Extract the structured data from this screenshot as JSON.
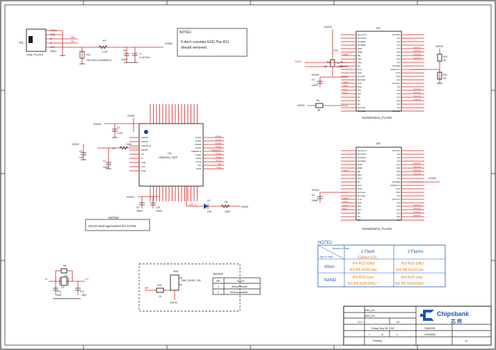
{
  "sheet": {
    "border_cols": [
      "1",
      "2",
      "3",
      "4",
      "5",
      "6"
    ],
    "border_rows": [
      "A",
      "B",
      "C",
      "D"
    ]
  },
  "p1": {
    "ref": "P1",
    "part": "USB_PLUGA",
    "pins": [
      "SHELL",
      "GND",
      "D+",
      "D-",
      "VCC",
      "SHELL",
      "SHELL"
    ],
    "nets": [
      "DM",
      "DP"
    ]
  },
  "r7": {
    "ref": "R7",
    "value": "2.2R"
  },
  "r11": {
    "ref": "R11",
    "value": "TDK AVRL161M9R0KTA"
  },
  "c6": {
    "ref": "C6",
    "value": "100nF"
  },
  "c7": {
    "ref": "C7",
    "value": "4.7uF/10V"
  },
  "vdd50": "VDD50",
  "note1": {
    "title": "NOTE1:",
    "lines": [
      "If don't consider ESD,The  R11",
      "should removed ."
    ]
  },
  "u3": {
    "ref": "U3",
    "part": "CBM2093_TQFP",
    "left_pins": [
      "VDD50",
      "VDD33",
      "VDD18_IN",
      "RESET",
      "XO",
      "XI",
      "TSB",
      "VCC",
      "GND"
    ],
    "right_pins": [
      "FOEN",
      "FCEN",
      "FWEN",
      "FCEN",
      "FRESETN",
      "FCEN",
      "FALE",
      "FCLE",
      "WP",
      "FR/B"
    ]
  },
  "c2": {
    "ref": "C2",
    "value": "4.7uF"
  },
  "c3": {
    "ref": "C3",
    "value": "1uF"
  },
  "c1": {
    "ref": "C1",
    "value": "100nF"
  },
  "r2": {
    "ref": "R2",
    "value": "100K"
  },
  "vdd33": "VDD33",
  "c9": {
    "ref": "C9",
    "value": "100nF"
  },
  "c10": {
    "ref": "C10",
    "value": "100nF"
  },
  "d1": {
    "ref": "D1",
    "part": "LED",
    "net": "LED_D"
  },
  "r6": {
    "ref": "R6",
    "value": "330R"
  },
  "note2": {
    "title": "NOTE2:",
    "text": "C8,C9 need Approaches the 13 PIN"
  },
  "u1": {
    "ref": "U1",
    "part": "NAND/43nm_FLASH",
    "left_pins": [
      "NC/VCC1",
      "NC/VSS1",
      "NC/R/B1",
      "NC/R/B2",
      "R/B1",
      "R/B2",
      "RE",
      "CE1",
      "CE2",
      "NC",
      "VCC",
      "VSS",
      "NC/CE3",
      "NC/CE4",
      "CLE",
      "ALE",
      "WE",
      "WP",
      "NC",
      "NC",
      "NC",
      "NC/VSS",
      "NC/VCC"
    ],
    "right_pins": [
      "NC/VSS",
      "NC",
      "NC",
      "NC",
      "IO7",
      "IO6",
      "IO5",
      "IO4",
      "NC",
      "NC/PRE",
      "PRE/VCC",
      "VCC",
      "VSS",
      "NC",
      "NC/VCC",
      "NC",
      "IO3",
      "IO2",
      "IO1",
      "IO0",
      "NC",
      "NC",
      "NC/VSS"
    ]
  },
  "u4": {
    "ref": "U4",
    "part": "NAND/43nm_FLASH"
  },
  "r3": {
    "ref": "R3",
    "value": "0R"
  },
  "r4": {
    "ref": "R4",
    "value": "2.2K"
  },
  "r5": {
    "ref": "R5",
    "value": "0R"
  },
  "r8": {
    "ref": "R8",
    "value": "0R"
  },
  "r24": {
    "ref": "R24",
    "value": "0R"
  },
  "r22": {
    "ref": "R22",
    "value": "0R"
  },
  "c4": {
    "ref": "C4",
    "value": "100nF"
  },
  "c5": {
    "ref": "C5",
    "value": "100nF"
  },
  "c11": {
    "ref": "C11",
    "value": "100nF"
  },
  "fdata": [
    "FDATA0",
    "FDATA1",
    "FDATA2",
    "FDATA3",
    "FDATA4",
    "FDATA5",
    "FDATA6",
    "FDATA7"
  ],
  "fnets": [
    "FREN",
    "FWEN",
    "FCEN",
    "FCLE",
    "FALE",
    "FR/B"
  ],
  "x1": {
    "ref": "X1",
    "part": "12MHz",
    "nets": [
      "XI",
      "XO"
    ]
  },
  "c12": {
    "ref": "C12",
    "value": "22pF"
  },
  "c13": {
    "ref": "C13",
    "value": "22pF"
  },
  "r5x": {
    "ref": "R5",
    "value": "1M"
  },
  "sw1": {
    "ref": "SW1",
    "part": "SMD_SLIDE_SW"
  },
  "r15": {
    "ref": "R15",
    "value": "1K"
  },
  "wp_net": "WP",
  "note3": {
    "title": "NOTE3:",
    "headers": [
      "WP",
      "MODE"
    ],
    "rows": [
      [
        "0",
        "Write protected"
      ],
      [
        "1",
        "Normal operation"
      ]
    ]
  },
  "note_table": {
    "title": "NOTE2:",
    "corner_top": "Number of Flash",
    "corner_bottom": "Type of Flash",
    "col1": "1 Flash",
    "col1_sub": "(Select U1)",
    "col2": "2 Flashs",
    "rows": [
      {
        "type": "43nm",
        "c1a": "R4    R22-DNU",
        "c1b": "R3   R5   R24-Use",
        "c2a": "R3    R22-DNU",
        "c2b": "R4   R5   R24-Use"
      },
      {
        "type": "NAND",
        "c1a": "R3    R22-Use",
        "c1b": "R4   R5   R24-DNU",
        "c2a": "R4    R22-Use",
        "c2b": "R3   R5   R24-DNU"
      }
    ]
  },
  "title_block": {
    "designer": "Allen_DU",
    "checker": "Allen_DU",
    "version": "V1.0",
    "size": "A3",
    "date": "Friday, May 08, 2009",
    "sheet": "1",
    "of": "of",
    "sheets": "1",
    "company": "Chipsbank",
    "company_cn": "芯 邦",
    "doc_no": "CBM2093",
    "doc_date": "20090508",
    "publicity": "Publicity",
    "page": "13"
  }
}
